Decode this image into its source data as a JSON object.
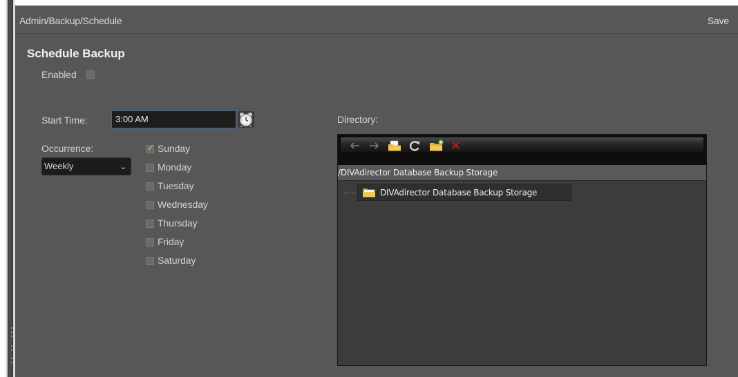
{
  "header": {
    "breadcrumb": "Admin/Backup/Schedule",
    "save_label": "Save"
  },
  "section": {
    "title": "Schedule Backup",
    "enabled_label": "Enabled",
    "enabled_checked": false
  },
  "schedule": {
    "start_time_label": "Start Time:",
    "start_time_value": "3:00 AM",
    "occurrence_label": "Occurrence:",
    "occurrence_value": "Weekly",
    "days": [
      {
        "label": "Sunday",
        "checked": true
      },
      {
        "label": "Monday",
        "checked": false
      },
      {
        "label": "Tuesday",
        "checked": false
      },
      {
        "label": "Wednesday",
        "checked": false
      },
      {
        "label": "Thursday",
        "checked": false
      },
      {
        "label": "Friday",
        "checked": false
      },
      {
        "label": "Saturday",
        "checked": false
      }
    ]
  },
  "directory": {
    "label": "Directory:",
    "current_path": "/DIVAdirector Database Backup Storage",
    "tree": [
      {
        "label": "DIVAdirector Database Backup Storage",
        "icon": "folder-icon"
      }
    ],
    "toolbar_icons": [
      "back-arrow-icon",
      "forward-arrow-icon",
      "open-folder-icon",
      "refresh-icon",
      "new-folder-icon",
      "delete-icon"
    ]
  },
  "colors": {
    "app_bg": "#575757",
    "input_border": "#3a6ea5",
    "check": "#8fd14f",
    "delete": "#b02020",
    "folder": "#e8b437"
  }
}
